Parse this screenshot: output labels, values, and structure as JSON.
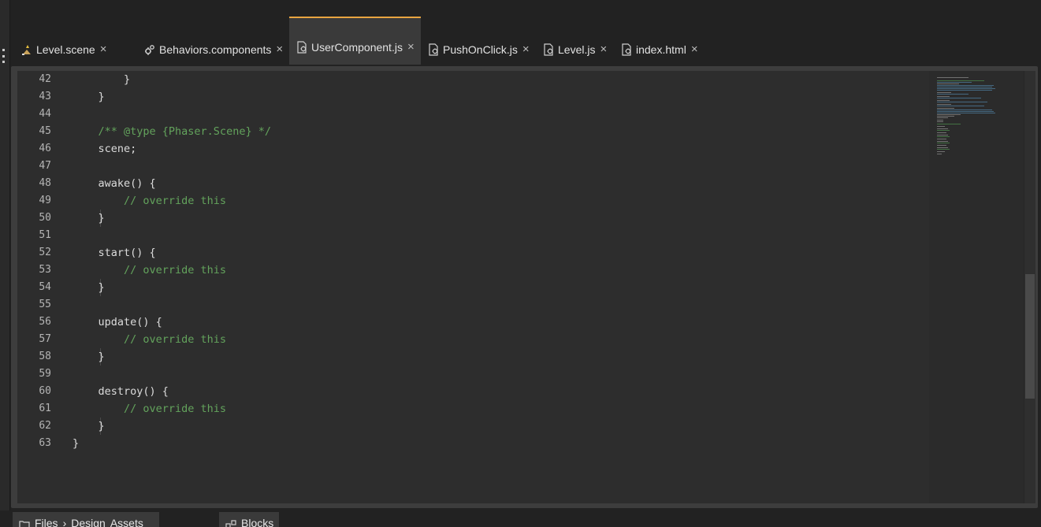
{
  "tabs": [
    {
      "label": "Level.scene",
      "icon": "scene-icon",
      "active": false
    },
    {
      "label": "Behaviors.components",
      "icon": "components-icon",
      "active": false
    },
    {
      "label": "UserComponent.js",
      "icon": "js-file-icon",
      "active": true
    },
    {
      "label": "PushOnClick.js",
      "icon": "js-file-icon",
      "active": false
    },
    {
      "label": "Level.js",
      "icon": "js-file-icon",
      "active": false
    },
    {
      "label": "index.html",
      "icon": "html-file-icon",
      "active": false
    }
  ],
  "close_glyph": "×",
  "editor": {
    "lines": [
      {
        "n": "42",
        "text": "        }",
        "type": "code"
      },
      {
        "n": "43",
        "text": "    }",
        "type": "code"
      },
      {
        "n": "44",
        "text": "",
        "type": "code"
      },
      {
        "n": "45",
        "text": "    /** @type {Phaser.Scene} */",
        "type": "comment"
      },
      {
        "n": "46",
        "text": "    scene;",
        "type": "code"
      },
      {
        "n": "47",
        "text": "",
        "type": "code"
      },
      {
        "n": "48",
        "text": "    awake() {",
        "type": "code"
      },
      {
        "n": "49",
        "text": "        // override this",
        "type": "comment"
      },
      {
        "n": "50",
        "text": "    }",
        "type": "code"
      },
      {
        "n": "51",
        "text": "",
        "type": "code"
      },
      {
        "n": "52",
        "text": "    start() {",
        "type": "code"
      },
      {
        "n": "53",
        "text": "        // override this",
        "type": "comment"
      },
      {
        "n": "54",
        "text": "    }",
        "type": "code"
      },
      {
        "n": "55",
        "text": "",
        "type": "code"
      },
      {
        "n": "56",
        "text": "    update() {",
        "type": "code"
      },
      {
        "n": "57",
        "text": "        // override this",
        "type": "comment"
      },
      {
        "n": "58",
        "text": "    }",
        "type": "code"
      },
      {
        "n": "59",
        "text": "",
        "type": "code"
      },
      {
        "n": "60",
        "text": "    destroy() {",
        "type": "code"
      },
      {
        "n": "61",
        "text": "        // override this",
        "type": "comment"
      },
      {
        "n": "62",
        "text": "    }",
        "type": "code"
      },
      {
        "n": "63",
        "text": "}",
        "type": "code"
      }
    ]
  },
  "bottom_panels": {
    "files_label": "Files",
    "separator": "›",
    "breadcrumb_design": "Design",
    "breadcrumb_assets": "Assets",
    "blocks_label": "Blocks"
  },
  "colors": {
    "accent": "#e8a540",
    "comment": "#63a35c",
    "code_text": "#dcdcdc",
    "line_number": "#b4b4b4"
  }
}
